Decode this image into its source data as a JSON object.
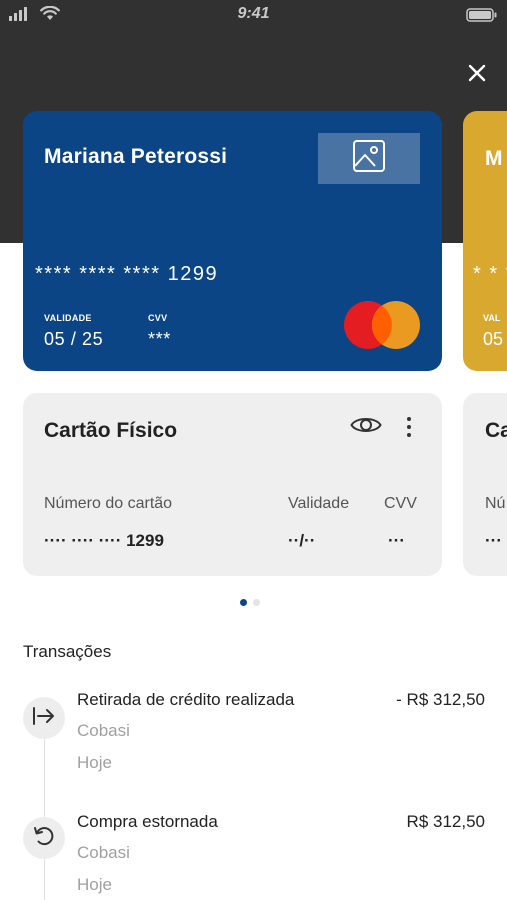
{
  "status_bar": {
    "time": "9:41",
    "icons": [
      "signal-icon",
      "wifi-icon",
      "battery-icon"
    ]
  },
  "header": {
    "close_icon": "close-icon"
  },
  "credit_card": {
    "holder_name": "Mariana Peterossi",
    "number_masked": "**** **** **** 1299",
    "validity_label": "VALIDADE",
    "validity_value": "05 / 25",
    "cvv_label": "CVV",
    "cvv_value": "***",
    "background_color": "#0b4585",
    "photo_icon": "image-icon",
    "brand_icon": "mastercard-logo"
  },
  "next_card_peek": {
    "background_color": "#d9a82e",
    "name_initial": "M",
    "number_fragment": "* * *",
    "label_fragment": "VAL",
    "value_fragment": "05"
  },
  "physical_card": {
    "title": "Cartão Físico",
    "eye_icon": "eye-icon",
    "more_icon": "more-vertical-icon",
    "number_label": "Número do cartão",
    "number_value": "···· ···· ···· 1299",
    "validity_label": "Validade",
    "validity_value": "··/··",
    "cvv_label": "CVV",
    "cvv_value": "···"
  },
  "physical_card_peek": {
    "title_fragment": "Ca",
    "label_fragment": "Nú",
    "value_fragment": "···"
  },
  "pagination": {
    "total": 2,
    "active_index": 0,
    "active_color": "#0b4585"
  },
  "transactions": {
    "title": "Transações",
    "items": [
      {
        "icon": "withdraw-arrow-icon",
        "description": "Retirada de crédito realizada",
        "merchant": "Cobasi",
        "date": "Hoje",
        "amount": "- R$ 312,50"
      },
      {
        "icon": "refund-rotate-icon",
        "description": "Compra estornada",
        "merchant": "Cobasi",
        "date": "Hoje",
        "amount": "R$ 312,50"
      }
    ]
  }
}
